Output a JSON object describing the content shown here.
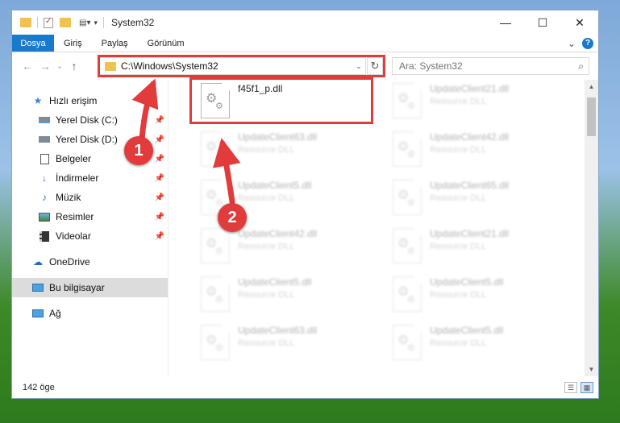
{
  "window": {
    "title": "System32",
    "controls": {
      "minimize": "—",
      "maximize": "☐",
      "close": "✕"
    }
  },
  "ribbon": {
    "tabs": [
      "Dosya",
      "Giriş",
      "Paylaş",
      "Görünüm"
    ],
    "expand": "⌄",
    "help": "?"
  },
  "navigation": {
    "back": "←",
    "forward": "→",
    "recent": "⌄",
    "up": "↑"
  },
  "address": {
    "path": "C:\\Windows\\System32",
    "dropdown": "⌄",
    "refresh": "↻"
  },
  "search": {
    "placeholder": "Ara: System32"
  },
  "nav_pane": {
    "quick_access": "Hızlı erişim",
    "pinned": [
      {
        "label": "Yerel Disk (C:)",
        "icon": "drive-icon"
      },
      {
        "label": "Yerel Disk (D:)",
        "icon": "drive-icon"
      },
      {
        "label": "Belgeler",
        "icon": "documents-icon"
      },
      {
        "label": "İndirmeler",
        "icon": "downloads-icon"
      },
      {
        "label": "Müzik",
        "icon": "music-icon"
      },
      {
        "label": "Resimler",
        "icon": "pictures-icon"
      },
      {
        "label": "Videolar",
        "icon": "videos-icon"
      }
    ],
    "onedrive": "OneDrive",
    "this_pc": "Bu bilgisayar",
    "network": "Ağ"
  },
  "files": {
    "highlighted": {
      "name": "f45f1_p.dll",
      "type": ""
    },
    "blurred": [
      {
        "name": "UpdateClient21.dll",
        "type": "Resource DLL"
      },
      {
        "name": "UpdateClient63.dll",
        "type": "Resource DLL"
      },
      {
        "name": "UpdateClient42.dll",
        "type": "Resource DLL"
      },
      {
        "name": "UpdateClient5.dll",
        "type": "Resource DLL"
      },
      {
        "name": "UpdateClient65.dll",
        "type": "Resource DLL"
      },
      {
        "name": "UpdateClient42.dll",
        "type": "Resource DLL"
      },
      {
        "name": "UpdateClient21.dll",
        "type": "Resource DLL"
      },
      {
        "name": "UpdateClient5.dll",
        "type": "Resource DLL"
      },
      {
        "name": "UpdateClient5.dll",
        "type": "Resource DLL"
      },
      {
        "name": "UpdateClient63.dll",
        "type": "Resource DLL"
      },
      {
        "name": "UpdateClient5.dll",
        "type": "Resource DLL"
      }
    ]
  },
  "status": {
    "count": "142 öge"
  },
  "callouts": [
    "1",
    "2"
  ],
  "colors": {
    "accent": "#1979ca",
    "highlight": "#e03c3c",
    "callout": "#e23b3b"
  }
}
